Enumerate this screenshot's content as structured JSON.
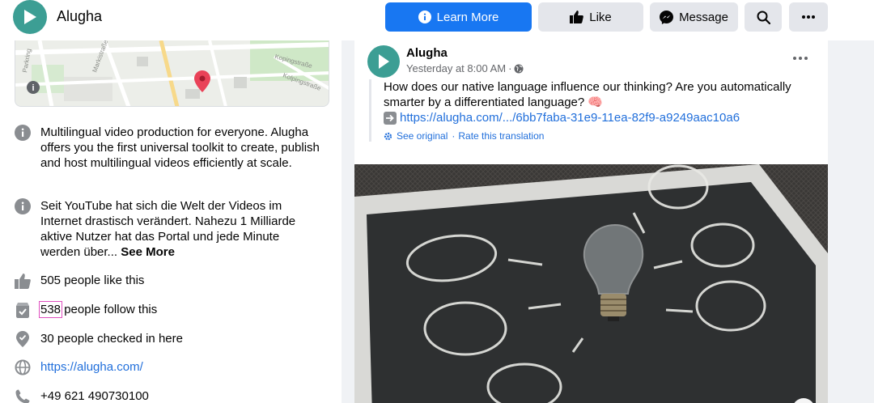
{
  "header": {
    "page_name": "Alugha",
    "learn_more": "Learn More",
    "like": "Like",
    "message": "Message"
  },
  "about": {
    "description": "Multilingual video production for everyone. Alugha offers you the first universal toolkit to create, publish and host multilingual videos efficiently at scale.",
    "story": "Seit YouTube hat sich die Welt der Videos im Internet drastisch verändert. Nahezu 1 Milliarde aktive Nutzer hat das Portal und jede Minute werden über...",
    "see_more": "See More",
    "likes": "505 people like this",
    "followers_count": "538",
    "followers_suffix": " people follow this",
    "checkins": "30 people checked in here",
    "website": "https://alugha.com/",
    "phone": "+49 621 490730100"
  },
  "map": {
    "street_labels": [
      "Parkring",
      "Markistraße",
      "Kopingstraße",
      "Kolpingstraße"
    ]
  },
  "post": {
    "author": "Alugha",
    "time": "Yesterday at 8:00 AM",
    "separator": "·",
    "text": "How does our native language influence our thinking? Are you automatically smarter by a differentiated language? 🧠",
    "link": "https://alugha.com/.../6bb7faba-31e9-11ea-82f9-a9249aac10a6",
    "see_original": "See original",
    "rate_translation": "Rate this translation",
    "translate_separator": "·"
  },
  "colors": {
    "brand": "#3c9e94",
    "primary_button": "#1877f2",
    "link": "#216fdb"
  }
}
